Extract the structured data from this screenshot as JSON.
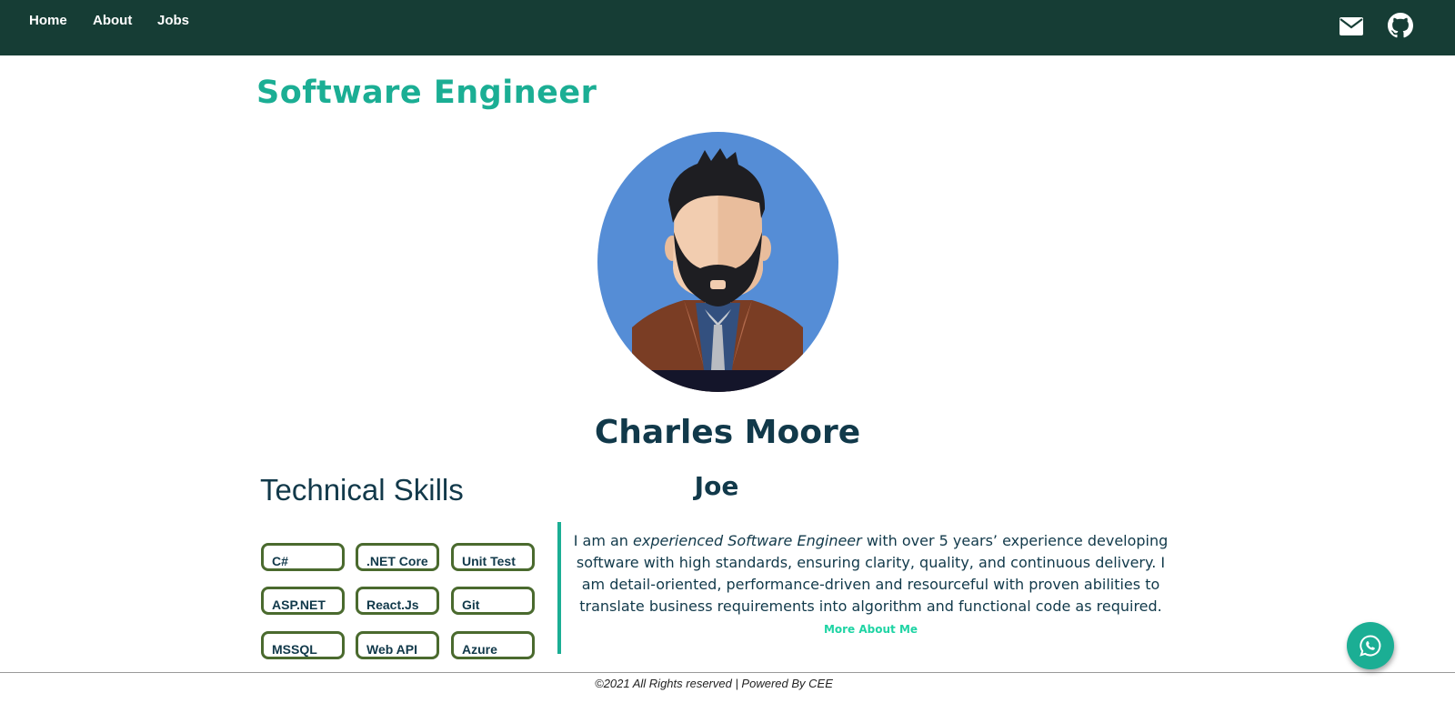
{
  "nav": {
    "links": [
      {
        "label": "Home"
      },
      {
        "label": "About"
      },
      {
        "label": "Jobs"
      }
    ],
    "icons": [
      "envelope-icon",
      "github-icon"
    ]
  },
  "hero": {
    "title": "Software Engineer",
    "name": "Charles Moore",
    "nickname": "Joe"
  },
  "skills": {
    "heading": "Technical Skills",
    "items": [
      "C#",
      ".NET Core",
      "Unit Test",
      "ASP.NET",
      "React.Js",
      "Git",
      "MSSQL",
      "Web API",
      "Azure"
    ]
  },
  "bio": {
    "intro": "I am an ",
    "emphasis": "experienced Software Engineer",
    "rest": " with over 5 years’ experience developing software with high standards, ensuring clarity, quality, and continuous delivery. I am detail-oriented, performance-driven and resourceful with proven abilities to translate business requirements into algorithm and functional code as required. ",
    "more_link": "More About Me"
  },
  "footer": {
    "text": "©2021 All Rights reserved | Powered By CEE"
  },
  "floating": {
    "icon": "whatsapp-icon"
  },
  "colors": {
    "navbar": "#163d35",
    "accent": "#1bae94",
    "text_dark": "#11394a",
    "chip_border": "#4a6a2e",
    "link": "#1fd4a4"
  }
}
